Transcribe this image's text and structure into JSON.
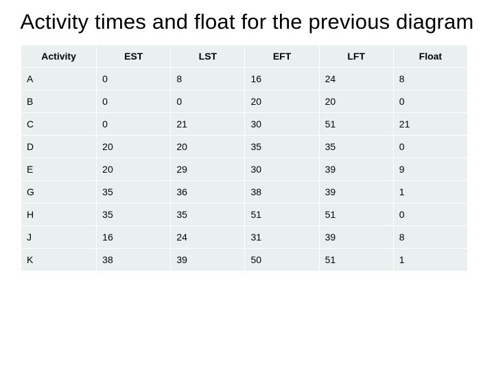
{
  "title": "Activity times and float for the previous diagram",
  "chart_data": {
    "type": "table",
    "columns": [
      "Activity",
      "EST",
      "LST",
      "EFT",
      "LFT",
      "Float"
    ],
    "rows": [
      [
        "A",
        "0",
        "8",
        "16",
        "24",
        "8"
      ],
      [
        "B",
        "0",
        "0",
        "20",
        "20",
        "0"
      ],
      [
        "C",
        "0",
        "21",
        "30",
        "51",
        "21"
      ],
      [
        "D",
        "20",
        "20",
        "35",
        "35",
        "0"
      ],
      [
        "E",
        "20",
        "29",
        "30",
        "39",
        "9"
      ],
      [
        "G",
        "35",
        "36",
        "38",
        "39",
        "1"
      ],
      [
        "H",
        "35",
        "35",
        "51",
        "51",
        "0"
      ],
      [
        "J",
        "16",
        "24",
        "31",
        "39",
        "8"
      ],
      [
        "K",
        "38",
        "39",
        "50",
        "51",
        "1"
      ]
    ]
  }
}
